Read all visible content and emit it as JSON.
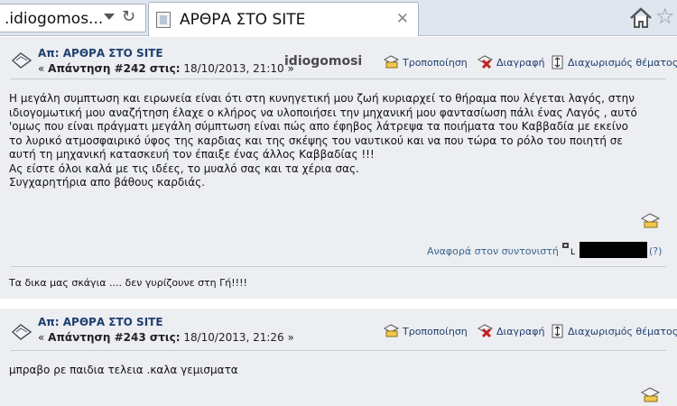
{
  "browser": {
    "url_text": ".idiogomos...",
    "refresh_symbol": "↻",
    "tab_title": "ΑΡΘΡΑ ΣΤΟ SITE",
    "tab_close": "✕",
    "star_symbol": "☆"
  },
  "posts": [
    {
      "title": "Απ: ΑΡΘΡΑ ΣΤΟ SITE",
      "reply_prefix": "« ",
      "reply_label": "Απάντηση #242 στις:",
      "reply_date": " 18/10/2013, 21:10 »",
      "author": "idiogomosi",
      "actions": {
        "edit": "Τροποποίηση",
        "delete": "Διαγραφή",
        "split": "Διαχωρισμός θέματος"
      },
      "body": [
        "Η μεγάλη συμπτωση και ειρωνεία είναι ότι στη κυνηγετική μου ζωή κυριαρχεί το θήραμα που λέγεται λαγός, στην",
        "ιδιογομωτική μου αναζήτηση έλαχε ο κλήρος να υλοποιήσει την μηχανική μου φαντασίωση πάλι ένας Λαγός , αυτό",
        "'ομως που είναι πράγματι μεγάλη σύμπτωση είναι πώς απο έφηβος λάτρεψα τα ποιήματα του Καββαδία με εκείνο",
        "το λυρικό ατμοσφαιρικό ύφος της καρδιας και της σκέψης του ναυτικού και να που τώρα το ρόλο του ποιητή σε",
        "αυτή τη μηχανική κατασκευή τον έπαιξε ένας άλλος Καββαδίας !!!",
        "Ας είστε όλοι καλά με τις ιδέες, το μυαλό σας και τα χέρια σας.",
        "Συγχαρητήρια απο βάθους καρδιάς."
      ],
      "report": "Αναφορά στον συντονιστή",
      "ip_icon_text": "L",
      "ip_suffix": "(?)",
      "signature": "Τα δικα μας σκάγια .... δεν γυρίζουνε στη Γή!!!!"
    },
    {
      "title": "Απ: ΑΡΘΡΑ ΣΤΟ SITE",
      "reply_prefix": "« ",
      "reply_label": "Απάντηση #243 στις:",
      "reply_date": " 18/10/2013, 21:26 »",
      "actions": {
        "edit": "Τροποποίηση",
        "delete": "Διαγραφή",
        "split": "Διαχωρισμός θέματος"
      },
      "body": [
        "μπραβο ρε παιδια τελεια .καλα γεμισματα"
      ]
    }
  ]
}
